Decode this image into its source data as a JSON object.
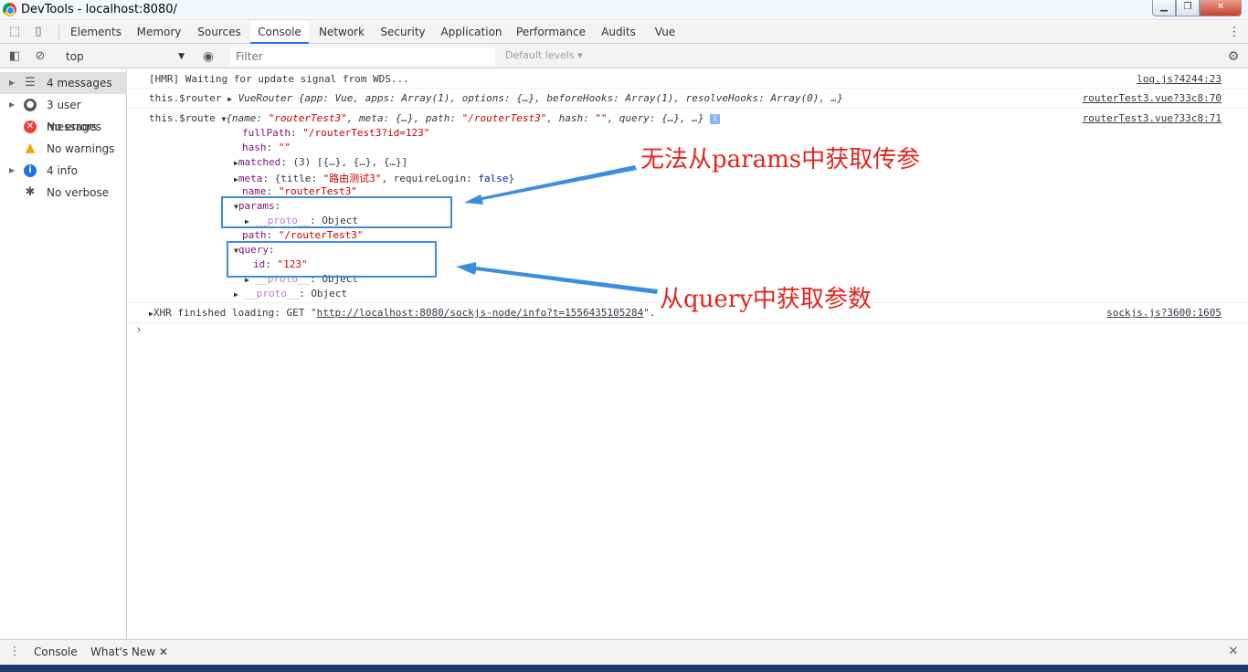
{
  "window": {
    "title": "DevTools - localhost:8080/"
  },
  "tabs": [
    "Elements",
    "Memory",
    "Sources",
    "Console",
    "Network",
    "Security",
    "Application",
    "Performance",
    "Audits",
    "Vue"
  ],
  "toolbar": {
    "context": "top",
    "filter_placeholder": "Filter",
    "levels": "Default levels ▾"
  },
  "sidebar": {
    "items": [
      {
        "label": "4 messages",
        "icon": "list-icon"
      },
      {
        "label": "3 user messages",
        "icon": "user-icon"
      },
      {
        "label": "No errors",
        "icon": "error-icon"
      },
      {
        "label": "No warnings",
        "icon": "warning-icon"
      },
      {
        "label": "4 info",
        "icon": "info-icon"
      },
      {
        "label": "No verbose",
        "icon": "verbose-icon"
      }
    ]
  },
  "console": {
    "msg1": {
      "text": "[HMR] Waiting for update signal from WDS...",
      "source": "log.js?4244:23"
    },
    "msg2": {
      "prefix": "this.$router",
      "obj": "VueRouter {app: Vue, apps: Array(1), options: {…}, beforeHooks: Array(1), resolveHooks: Array(0), …}",
      "source": "routerTest3.vue?33c8:70"
    },
    "msg3": {
      "prefix": "this.$route",
      "summary_start": "{name: ",
      "summary_name": "\"routerTest3\"",
      "summary_mid": ", meta: {…}, path: ",
      "summary_path": "\"/routerTest3\"",
      "summary_hash_label": ", hash: ",
      "summary_hash": "\"\"",
      "summary_end": ", query: {…}, …}",
      "source": "routerTest3.vue?33c8:71",
      "fullPath_key": "fullPath",
      "fullPath_val": "\"/routerTest3?id=123\"",
      "hash_key": "hash",
      "hash_val": "\"\"",
      "matched_key": "matched",
      "matched_val": "(3) [{…}, {…}, {…}]",
      "meta_key": "meta",
      "meta_open": "{title: ",
      "meta_title": "\"路由测试3\"",
      "meta_mid": ", requireLogin: ",
      "meta_false": "false",
      "meta_close": "}",
      "name_key": "name",
      "name_val": "\"routerTest3\"",
      "params_key": "params",
      "proto_key": "__proto__",
      "proto_val": "Object",
      "path_key": "path",
      "path_val": "\"/routerTest3\"",
      "query_key": "query",
      "id_key": "id",
      "id_val": "\"123\""
    },
    "msg4": {
      "text_pre": "XHR finished loading: GET \"",
      "url": "http://localhost:8080/sockjs-node/info?t=1556435105284",
      "text_post": "\".",
      "source": "sockjs.js?3600:1605"
    }
  },
  "annotations": {
    "top": "无法从params中获取传参",
    "bottom": "从query中获取参数"
  },
  "drawer": {
    "console": "Console",
    "whats_new": "What's New"
  },
  "colors": {
    "accent": "#1a73e8",
    "annotation": "#e0261f",
    "highlight": "#3b8de0"
  }
}
